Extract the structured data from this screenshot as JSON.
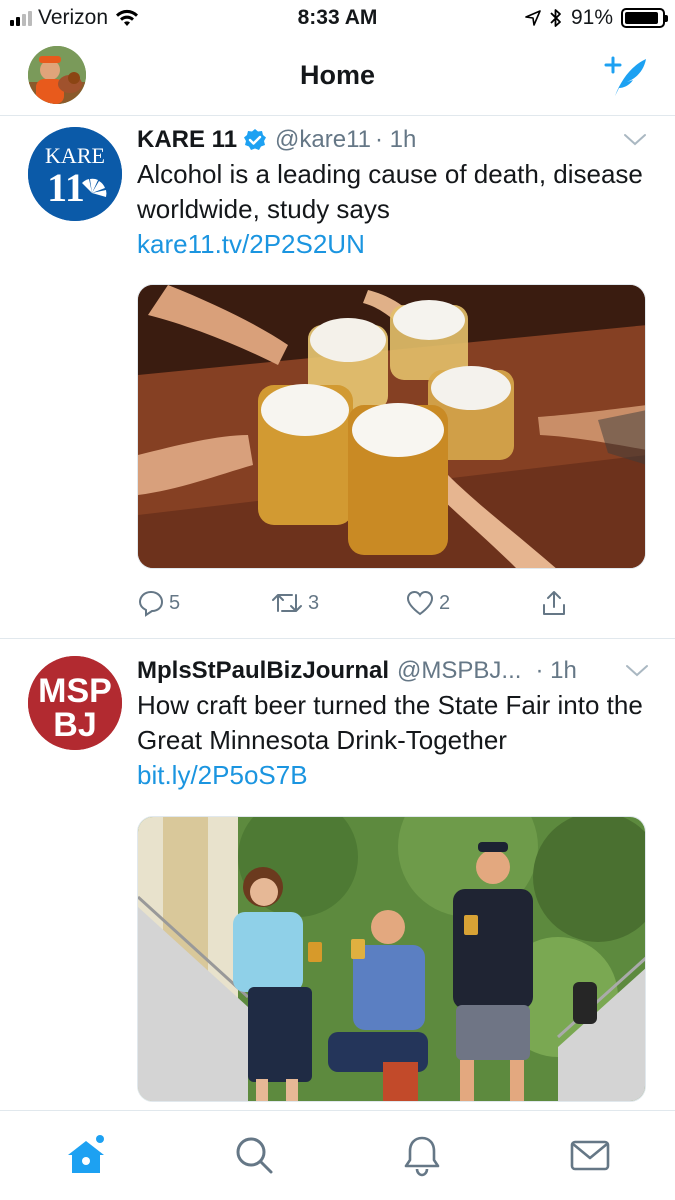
{
  "status_bar": {
    "carrier": "Verizon",
    "time": "8:33 AM",
    "battery": "91%",
    "battery_level": 0.91,
    "icons": [
      "signal-icon",
      "wifi-icon",
      "location-icon",
      "bluetooth-icon",
      "battery-icon"
    ]
  },
  "nav": {
    "title": "Home",
    "icons": [
      "profile-avatar",
      "compose-tweet-icon"
    ]
  },
  "tweets": [
    {
      "name": "KARE 11",
      "verified": true,
      "handle": "@kare11",
      "time": "· 1h",
      "text": "Alcohol is a leading cause of death, disease worldwide, study says",
      "link": "kare11.tv/2P2S2UN",
      "avatar_text_top": "KARE",
      "avatar_text_bottom": "11",
      "media_alt": "beer-mugs-toast-photo",
      "actions": {
        "replies": "5",
        "retweets": "3",
        "likes": "2"
      }
    },
    {
      "name": "MplsStPaulBizJournal",
      "verified": false,
      "handle": "@MSPBJ...",
      "time": "· 1h",
      "text": "How craft beer turned the State Fair into the Great Minnesota Drink-Together",
      "link": "bit.ly/2P5oS7B",
      "avatar_text_top": "MSP",
      "avatar_text_bottom": "BJ",
      "media_alt": "three-people-with-beers-photo"
    }
  ],
  "tab_bar": {
    "icons": [
      "home-icon",
      "search-icon",
      "notifications-icon",
      "messages-icon"
    ]
  },
  "colors": {
    "twitter_blue": "#1da1f2",
    "link_blue": "#1b95e0",
    "gray_text": "#657786",
    "kare_blue": "#0b5aa8",
    "mspbj_red": "#b22a30"
  }
}
